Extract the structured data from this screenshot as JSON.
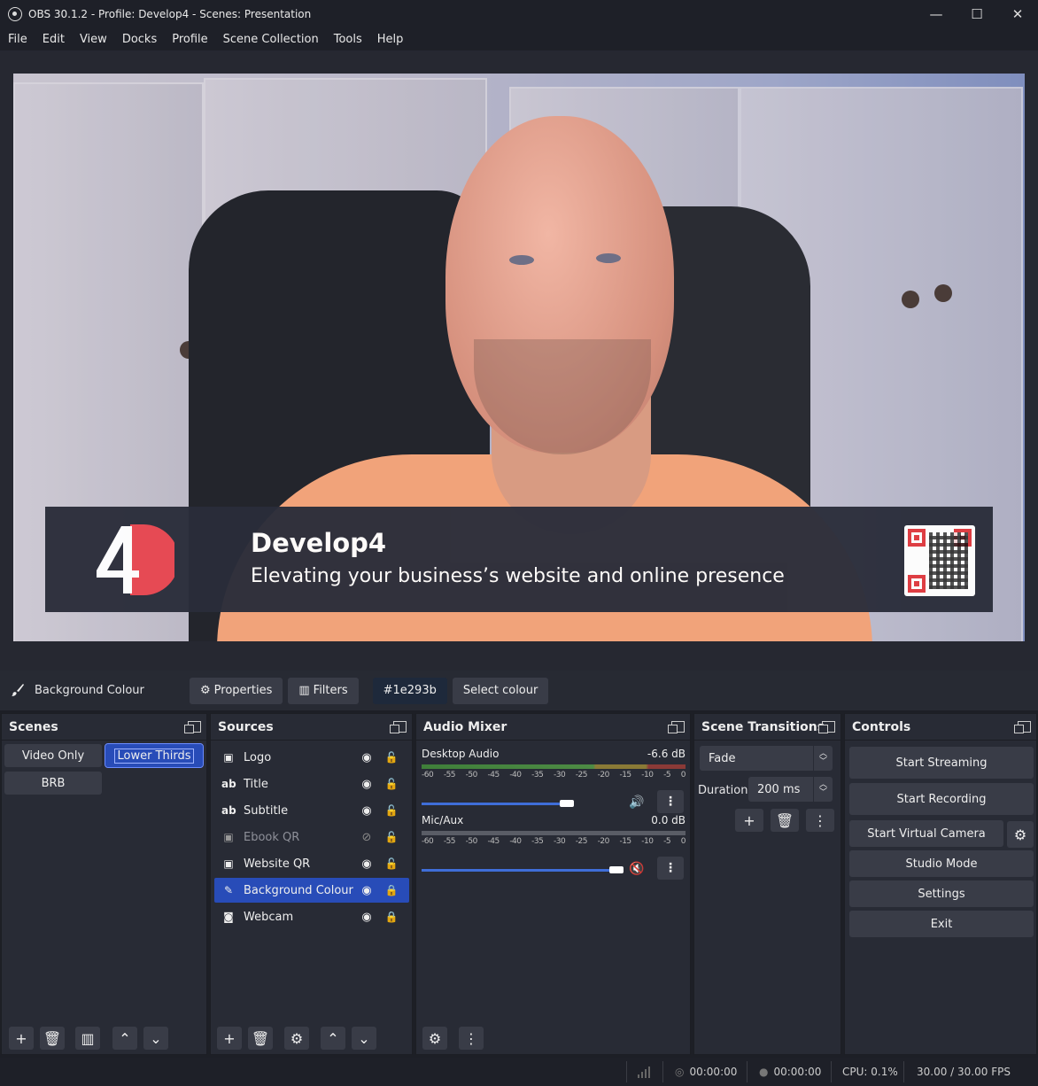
{
  "window": {
    "title": "OBS 30.1.2 - Profile: Develop4 - Scenes: Presentation",
    "minimize": "—",
    "maximize": "☐",
    "close": "✕"
  },
  "menu": [
    "File",
    "Edit",
    "View",
    "Docks",
    "Profile",
    "Scene Collection",
    "Tools",
    "Help"
  ],
  "preview": {
    "lower_third": {
      "name": "Develop4",
      "tagline": "Elevating your business’s website and online presence"
    }
  },
  "context_bar": {
    "source_name": "Background Colour",
    "properties": "Properties",
    "filters": "Filters",
    "color_value": "#1e293b",
    "select_colour": "Select colour"
  },
  "scenes": {
    "title": "Scenes",
    "items": [
      {
        "label": "Video Only",
        "selected": false
      },
      {
        "label": "Lower Thirds",
        "selected": true
      },
      {
        "label": "BRB",
        "selected": false
      }
    ]
  },
  "sources": {
    "title": "Sources",
    "items": [
      {
        "label": "Logo",
        "icon": "image-icon",
        "visible": true,
        "locked": false
      },
      {
        "label": "Title",
        "icon": "text-icon",
        "visible": true,
        "locked": false
      },
      {
        "label": "Subtitle",
        "icon": "text-icon",
        "visible": true,
        "locked": false
      },
      {
        "label": "Ebook QR",
        "icon": "image-icon",
        "visible": false,
        "locked": false
      },
      {
        "label": "Website QR",
        "icon": "image-icon",
        "visible": true,
        "locked": false
      },
      {
        "label": "Background Colour",
        "icon": "brush-icon",
        "visible": true,
        "locked": true
      },
      {
        "label": "Webcam",
        "icon": "camera-icon",
        "visible": true,
        "locked": true
      }
    ]
  },
  "audio_mixer": {
    "title": "Audio Mixer",
    "scale": [
      "-60",
      "-55",
      "-50",
      "-45",
      "-40",
      "-35",
      "-30",
      "-25",
      "-20",
      "-15",
      "-10",
      "-5",
      "0"
    ],
    "channels": [
      {
        "name": "Desktop Audio",
        "db": "-6.6 dB",
        "level": 0.55,
        "muted": false
      },
      {
        "name": "Mic/Aux",
        "db": "0.0 dB",
        "level": 0.74,
        "muted": true
      }
    ]
  },
  "transitions": {
    "title": "Scene Transitions",
    "selected": "Fade",
    "duration_label": "Duration",
    "duration_value": "200 ms"
  },
  "controls": {
    "title": "Controls",
    "start_streaming": "Start Streaming",
    "start_recording": "Start Recording",
    "start_virtual_camera": "Start Virtual Camera",
    "studio_mode": "Studio Mode",
    "settings": "Settings",
    "exit": "Exit"
  },
  "status": {
    "stream_time": "00:00:00",
    "record_time": "00:00:00",
    "cpu": "CPU: 0.1%",
    "fps": "30.00 / 30.00 FPS"
  }
}
